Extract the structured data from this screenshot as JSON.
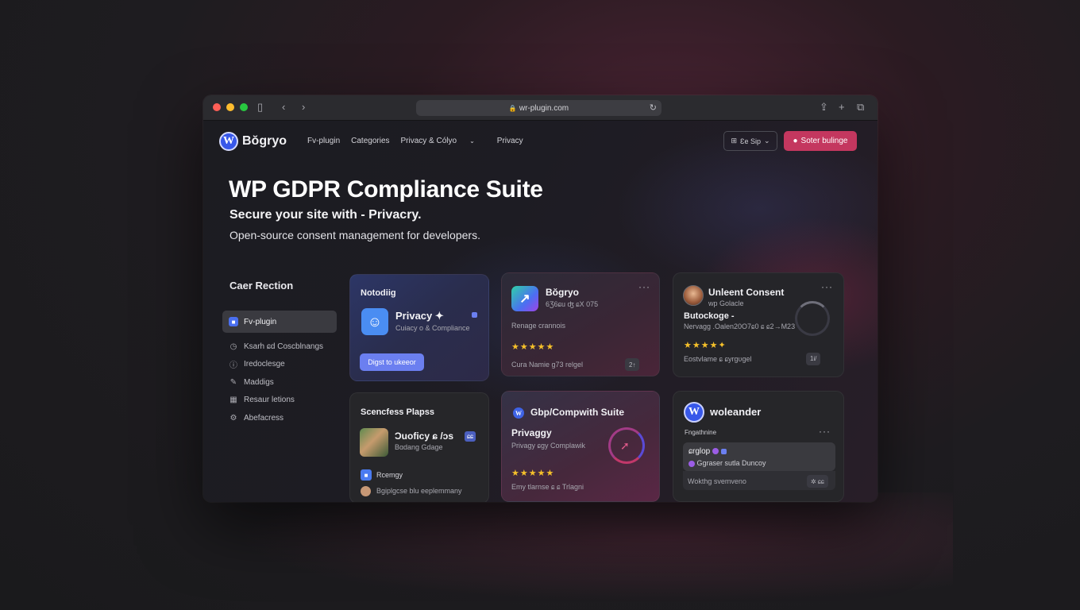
{
  "browser": {
    "url": "wr-plugin.com"
  },
  "nav": {
    "brand": "Bŏgryo",
    "links": [
      "Fv-plugin",
      "Categories",
      "Privacy & Cólyo",
      "Privacy"
    ],
    "lang_label": "Ɛe Sip",
    "cta_label": "Soter bulinge"
  },
  "hero": {
    "title": "WP GDPR Compliance Suite",
    "subtitle": "Secure your site with - Privacry.",
    "description": "Open-source consent management for developers."
  },
  "sidebar": {
    "title": "Caer Rection",
    "items": [
      {
        "label": "Fv-plugin",
        "icon": "plugin-icon"
      },
      {
        "label": "Ksarh ɕd Coscblnangs",
        "icon": "clock-icon"
      },
      {
        "label": "Iredoclesge",
        "icon": "info-icon"
      },
      {
        "label": "Maddigs",
        "icon": "pen-icon"
      },
      {
        "label": "Resaur letions",
        "icon": "grid-icon"
      },
      {
        "label": "Abefacress",
        "icon": "gear-icon"
      }
    ]
  },
  "cards": {
    "c1": {
      "header": "Notodiig",
      "title": "Privacy ✦",
      "subtitle": "Cuiacy o & Compliance",
      "button": "Digst to ukeeor"
    },
    "c2": {
      "title": "Bŏgryo",
      "meta": "6Ʒ6ɕu ʤ ɕX 075",
      "desc": "Renage crannois",
      "stars": "★★★★★",
      "footer": "Cura Namie g73 relgel",
      "pill": "2↑"
    },
    "c3": {
      "title": "Unleent Consent",
      "meta": "wp Golacle",
      "sub": "Butockoge -",
      "detail": "Nervagg .Oalen20O7ɕ0 ɕ ɕ2→M23",
      "stars": "★★★★✦",
      "footer": "Eostvlame ɕ ɕyrgʋgel",
      "pill": "1Ꭵ/"
    },
    "c4": {
      "header": "Scencfess Plapss",
      "title": "Ɔuoficy ɕ /ɔs",
      "tag": "ɕɕ",
      "sub": "Bɑdang Gdage",
      "item1": "Rcemgy",
      "item2": "Bgiplgcse blu eeplemmany"
    },
    "c5": {
      "title": "Gbp/Compwith Suite",
      "big": "Privaggy",
      "sub": "Privagy ɕgy Complawik",
      "stars": "★★★★★",
      "footer": "Emy tlarnse ɕ ɕ Trlagni"
    },
    "c6": {
      "title": "woleander",
      "header": "Fngathnine",
      "inner_title": "ɕrglop",
      "inner_sub": "Ggraser sutla Duncoy",
      "footer": "Wokthg svemveno",
      "pill": "✲ ɕɕ"
    }
  },
  "colors": {
    "accent": "#c4375f",
    "brand": "#3858e9",
    "star": "#f6c12a"
  }
}
